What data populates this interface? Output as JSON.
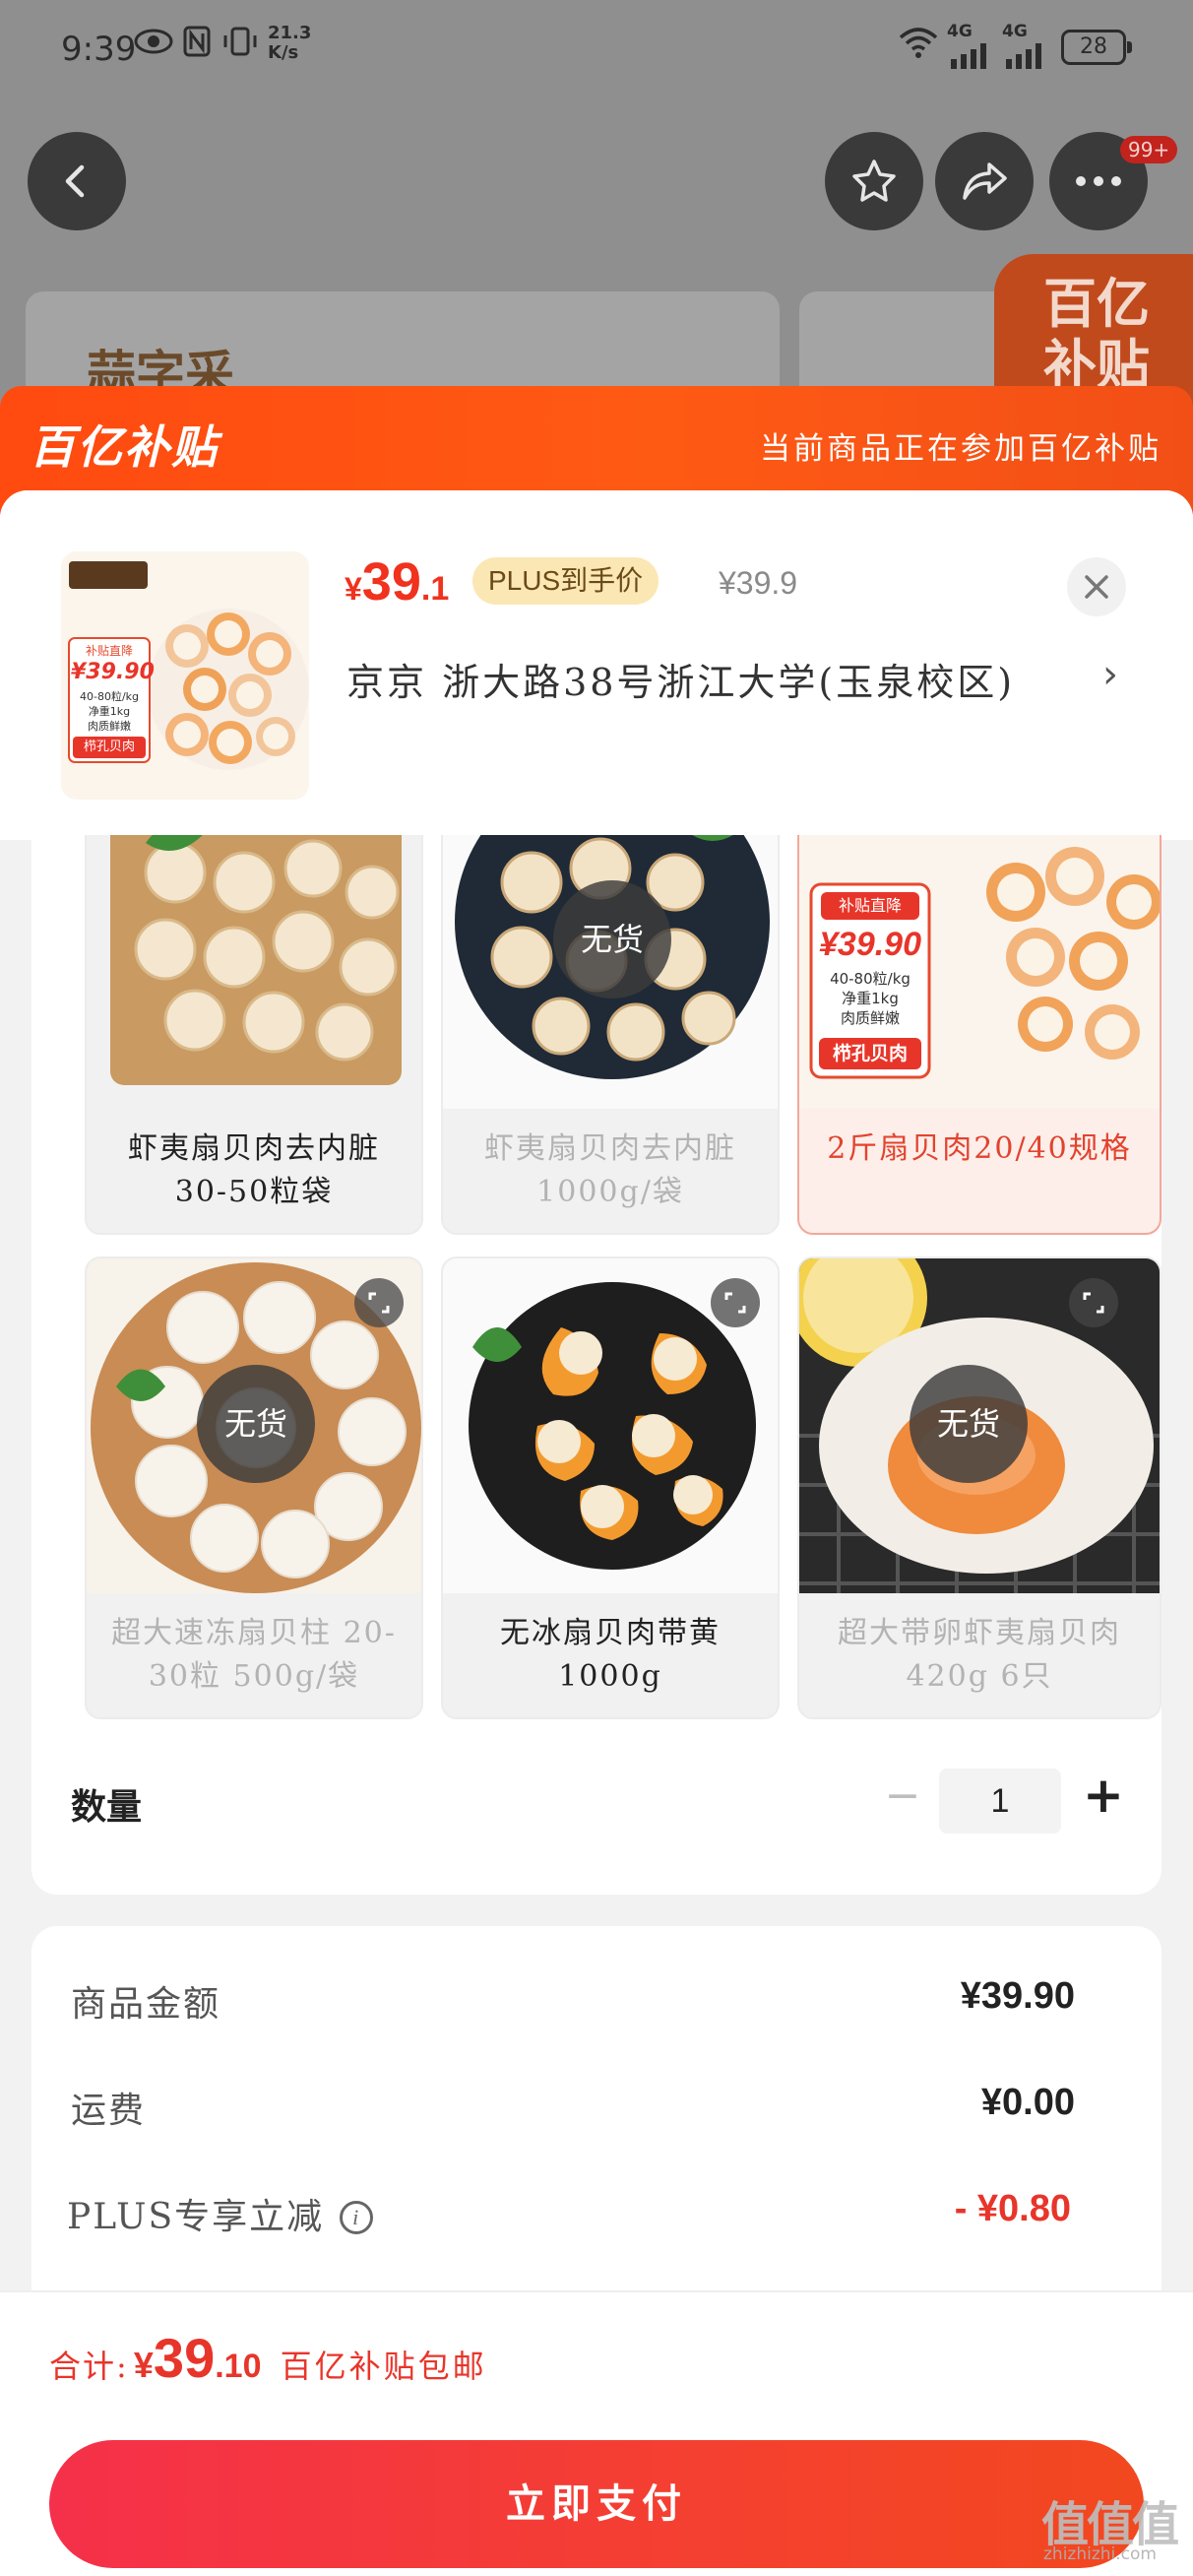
{
  "status_bar": {
    "time": "9:39",
    "speed_top": "21.3",
    "speed_unit": "K/s",
    "net1": "4G",
    "net2": "4G",
    "battery": "28"
  },
  "background": {
    "notification_badge": "99+",
    "brand_partial": "蒜字采",
    "subsidy_badge": "百亿补贴"
  },
  "sheet_header": {
    "logo": "百亿补贴",
    "note": "当前商品正在参加百亿补贴"
  },
  "product": {
    "price_symbol": "¥",
    "price_int": "39",
    "price_dec": ".1",
    "plus_tag": "PLUS到手价",
    "original_price": "¥39.9",
    "address": "京京   浙大路38号浙江大学(玉泉校区)",
    "thumb_badge_top": "补贴直降",
    "thumb_badge_price": "¥39.90",
    "thumb_badge_line1": "40-80粒/kg",
    "thumb_badge_line2": "净重1kg",
    "thumb_badge_line3": "肉质鲜嫩",
    "thumb_badge_bottom": "栉孔贝肉"
  },
  "specs": [
    {
      "label": "虾夷扇贝肉去内脏 30-50粒袋",
      "available": true,
      "selected": false
    },
    {
      "label": "虾夷扇贝肉去内脏 1000g/袋",
      "available": false,
      "selected": false,
      "nostock": "无货"
    },
    {
      "label": "2斤扇贝肉20/40规格",
      "available": true,
      "selected": true
    },
    {
      "label": "超大速冻扇贝柱 20-30粒 500g/袋",
      "available": false,
      "selected": false,
      "nostock": "无货"
    },
    {
      "label": "无冰扇贝肉带黄 1000g",
      "available": true,
      "selected": false
    },
    {
      "label": "超大带卵虾夷扇贝肉 420g  6只",
      "available": false,
      "selected": false,
      "nostock": "无货"
    }
  ],
  "quantity": {
    "label": "数量",
    "minus": "−",
    "value": "1",
    "plus": "+"
  },
  "costs": {
    "goods_label": "商品金额",
    "goods_value": "¥39.90",
    "shipping_label": "运费",
    "shipping_value": "¥0.00",
    "plus_label": "PLUS专享立减",
    "plus_value": "- ¥0.80"
  },
  "footer": {
    "total_label": "合计:",
    "total_symbol": "¥",
    "total_int": "39",
    "total_dec": ".10",
    "total_note": "百亿补贴包邮",
    "pay_button": "立即支付",
    "watermark": "值值值",
    "watermark_sub": "zhizhizhi.com"
  },
  "colors": {
    "accent": "#f0321e",
    "header_orange": "#ff4a10",
    "plus_gold": "#fbe7b3"
  }
}
